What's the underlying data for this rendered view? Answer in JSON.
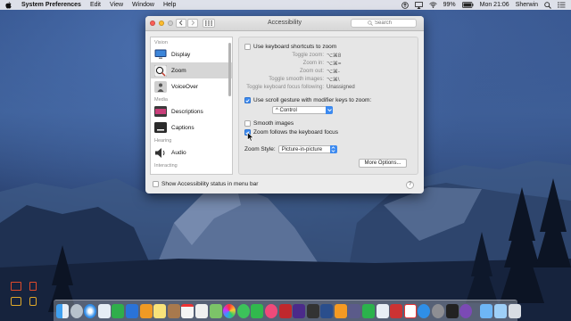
{
  "menubar": {
    "app_name": "System Preferences",
    "menus": [
      "Edit",
      "View",
      "Window",
      "Help"
    ],
    "battery": "99%",
    "clock": "Mon 21:06",
    "user": "Sherwin"
  },
  "window": {
    "title": "Accessibility",
    "search_placeholder": "Search"
  },
  "sidebar": {
    "sections": {
      "vision": "Vision",
      "media": "Media",
      "hearing": "Hearing",
      "interacting": "Interacting"
    },
    "items": [
      {
        "label": "Display",
        "icon": "display-icon"
      },
      {
        "label": "Zoom",
        "icon": "zoom-icon",
        "selected": true
      },
      {
        "label": "VoiceOver",
        "icon": "voiceover-icon"
      },
      {
        "label": "Descriptions",
        "icon": "descriptions-icon"
      },
      {
        "label": "Captions",
        "icon": "captions-icon"
      },
      {
        "label": "Audio",
        "icon": "audio-icon"
      }
    ]
  },
  "zoom": {
    "keyboard_shortcuts_label": "Use keyboard shortcuts to zoom",
    "keyboard_shortcuts_checked": false,
    "shortcuts": [
      {
        "key": "Toggle zoom:",
        "value": "⌥⌘8"
      },
      {
        "key": "Zoom in:",
        "value": "⌥⌘="
      },
      {
        "key": "Zoom out:",
        "value": "⌥⌘-"
      },
      {
        "key": "Toggle smooth images:",
        "value": "⌥⌘\\"
      },
      {
        "key": "Toggle keyboard focus following:",
        "value": "Unassigned"
      }
    ],
    "scroll_gesture_label": "Use scroll gesture with modifier keys to zoom:",
    "scroll_gesture_checked": true,
    "modifier_value": "^ Control",
    "smooth_images_label": "Smooth images",
    "smooth_images_checked": false,
    "follow_focus_label": "Zoom follows the keyboard focus",
    "follow_focus_checked": true,
    "zoom_style_label": "Zoom Style:",
    "zoom_style_value": "Picture-in-picture",
    "more_options_label": "More Options..."
  },
  "footer": {
    "status_label": "Show Accessibility status in menu bar",
    "status_checked": false,
    "help": "?"
  }
}
